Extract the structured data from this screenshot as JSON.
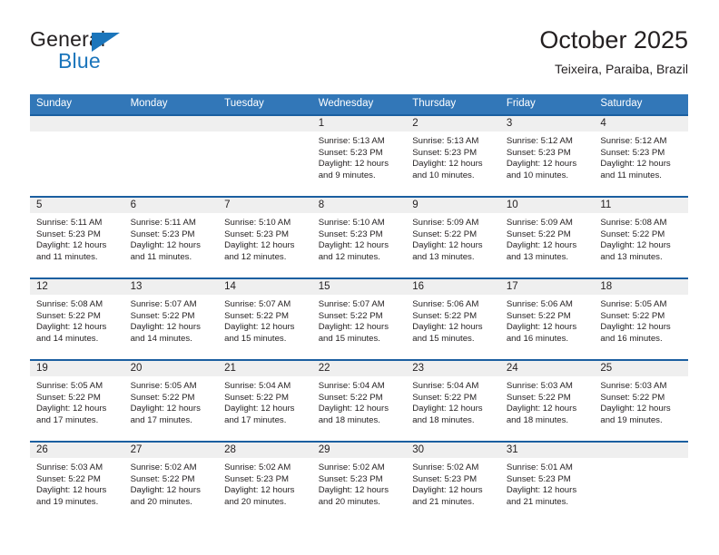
{
  "brand": {
    "name_part1": "General",
    "name_part2": "Blue",
    "logo_icon": "triangle-flag-icon"
  },
  "header": {
    "title": "October 2025",
    "subtitle": "Teixeira, Paraiba, Brazil",
    "accent_color": "#3277b8",
    "accent_border_color": "#1b5fa0",
    "daynum_band_color": "#efefef"
  },
  "calendar": {
    "weekday_headers": [
      "Sunday",
      "Monday",
      "Tuesday",
      "Wednesday",
      "Thursday",
      "Friday",
      "Saturday"
    ],
    "weeks": [
      [
        {
          "day": "",
          "lines": []
        },
        {
          "day": "",
          "lines": []
        },
        {
          "day": "",
          "lines": []
        },
        {
          "day": "1",
          "lines": [
            "Sunrise: 5:13 AM",
            "Sunset: 5:23 PM",
            "Daylight: 12 hours",
            "and 9 minutes."
          ]
        },
        {
          "day": "2",
          "lines": [
            "Sunrise: 5:13 AM",
            "Sunset: 5:23 PM",
            "Daylight: 12 hours",
            "and 10 minutes."
          ]
        },
        {
          "day": "3",
          "lines": [
            "Sunrise: 5:12 AM",
            "Sunset: 5:23 PM",
            "Daylight: 12 hours",
            "and 10 minutes."
          ]
        },
        {
          "day": "4",
          "lines": [
            "Sunrise: 5:12 AM",
            "Sunset: 5:23 PM",
            "Daylight: 12 hours",
            "and 11 minutes."
          ]
        }
      ],
      [
        {
          "day": "5",
          "lines": [
            "Sunrise: 5:11 AM",
            "Sunset: 5:23 PM",
            "Daylight: 12 hours",
            "and 11 minutes."
          ]
        },
        {
          "day": "6",
          "lines": [
            "Sunrise: 5:11 AM",
            "Sunset: 5:23 PM",
            "Daylight: 12 hours",
            "and 11 minutes."
          ]
        },
        {
          "day": "7",
          "lines": [
            "Sunrise: 5:10 AM",
            "Sunset: 5:23 PM",
            "Daylight: 12 hours",
            "and 12 minutes."
          ]
        },
        {
          "day": "8",
          "lines": [
            "Sunrise: 5:10 AM",
            "Sunset: 5:23 PM",
            "Daylight: 12 hours",
            "and 12 minutes."
          ]
        },
        {
          "day": "9",
          "lines": [
            "Sunrise: 5:09 AM",
            "Sunset: 5:22 PM",
            "Daylight: 12 hours",
            "and 13 minutes."
          ]
        },
        {
          "day": "10",
          "lines": [
            "Sunrise: 5:09 AM",
            "Sunset: 5:22 PM",
            "Daylight: 12 hours",
            "and 13 minutes."
          ]
        },
        {
          "day": "11",
          "lines": [
            "Sunrise: 5:08 AM",
            "Sunset: 5:22 PM",
            "Daylight: 12 hours",
            "and 13 minutes."
          ]
        }
      ],
      [
        {
          "day": "12",
          "lines": [
            "Sunrise: 5:08 AM",
            "Sunset: 5:22 PM",
            "Daylight: 12 hours",
            "and 14 minutes."
          ]
        },
        {
          "day": "13",
          "lines": [
            "Sunrise: 5:07 AM",
            "Sunset: 5:22 PM",
            "Daylight: 12 hours",
            "and 14 minutes."
          ]
        },
        {
          "day": "14",
          "lines": [
            "Sunrise: 5:07 AM",
            "Sunset: 5:22 PM",
            "Daylight: 12 hours",
            "and 15 minutes."
          ]
        },
        {
          "day": "15",
          "lines": [
            "Sunrise: 5:07 AM",
            "Sunset: 5:22 PM",
            "Daylight: 12 hours",
            "and 15 minutes."
          ]
        },
        {
          "day": "16",
          "lines": [
            "Sunrise: 5:06 AM",
            "Sunset: 5:22 PM",
            "Daylight: 12 hours",
            "and 15 minutes."
          ]
        },
        {
          "day": "17",
          "lines": [
            "Sunrise: 5:06 AM",
            "Sunset: 5:22 PM",
            "Daylight: 12 hours",
            "and 16 minutes."
          ]
        },
        {
          "day": "18",
          "lines": [
            "Sunrise: 5:05 AM",
            "Sunset: 5:22 PM",
            "Daylight: 12 hours",
            "and 16 minutes."
          ]
        }
      ],
      [
        {
          "day": "19",
          "lines": [
            "Sunrise: 5:05 AM",
            "Sunset: 5:22 PM",
            "Daylight: 12 hours",
            "and 17 minutes."
          ]
        },
        {
          "day": "20",
          "lines": [
            "Sunrise: 5:05 AM",
            "Sunset: 5:22 PM",
            "Daylight: 12 hours",
            "and 17 minutes."
          ]
        },
        {
          "day": "21",
          "lines": [
            "Sunrise: 5:04 AM",
            "Sunset: 5:22 PM",
            "Daylight: 12 hours",
            "and 17 minutes."
          ]
        },
        {
          "day": "22",
          "lines": [
            "Sunrise: 5:04 AM",
            "Sunset: 5:22 PM",
            "Daylight: 12 hours",
            "and 18 minutes."
          ]
        },
        {
          "day": "23",
          "lines": [
            "Sunrise: 5:04 AM",
            "Sunset: 5:22 PM",
            "Daylight: 12 hours",
            "and 18 minutes."
          ]
        },
        {
          "day": "24",
          "lines": [
            "Sunrise: 5:03 AM",
            "Sunset: 5:22 PM",
            "Daylight: 12 hours",
            "and 18 minutes."
          ]
        },
        {
          "day": "25",
          "lines": [
            "Sunrise: 5:03 AM",
            "Sunset: 5:22 PM",
            "Daylight: 12 hours",
            "and 19 minutes."
          ]
        }
      ],
      [
        {
          "day": "26",
          "lines": [
            "Sunrise: 5:03 AM",
            "Sunset: 5:22 PM",
            "Daylight: 12 hours",
            "and 19 minutes."
          ]
        },
        {
          "day": "27",
          "lines": [
            "Sunrise: 5:02 AM",
            "Sunset: 5:22 PM",
            "Daylight: 12 hours",
            "and 20 minutes."
          ]
        },
        {
          "day": "28",
          "lines": [
            "Sunrise: 5:02 AM",
            "Sunset: 5:23 PM",
            "Daylight: 12 hours",
            "and 20 minutes."
          ]
        },
        {
          "day": "29",
          "lines": [
            "Sunrise: 5:02 AM",
            "Sunset: 5:23 PM",
            "Daylight: 12 hours",
            "and 20 minutes."
          ]
        },
        {
          "day": "30",
          "lines": [
            "Sunrise: 5:02 AM",
            "Sunset: 5:23 PM",
            "Daylight: 12 hours",
            "and 21 minutes."
          ]
        },
        {
          "day": "31",
          "lines": [
            "Sunrise: 5:01 AM",
            "Sunset: 5:23 PM",
            "Daylight: 12 hours",
            "and 21 minutes."
          ]
        },
        {
          "day": "",
          "lines": []
        }
      ]
    ]
  }
}
